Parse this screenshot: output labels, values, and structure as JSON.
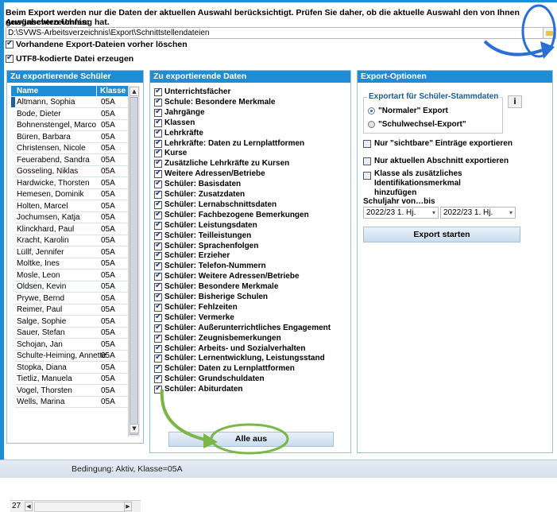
{
  "info_text": "Beim Export werden nur die Daten der aktuellen Auswahl berücksichtigt. Prüfen Sie daher, ob die aktuelle Auswahl den von Ihnen gewünschten Umfang hat.",
  "output_dir_label": "Ausgabeverzeichnis:",
  "output_dir_value": "D:\\SVWS-Arbeitsverzeichnis\\Export\\Schnittstellendateien",
  "options_top": [
    {
      "label": "Vorhandene Export-Dateien vorher löschen",
      "checked": true
    },
    {
      "label": "UTF8-kodierte Datei erzeugen",
      "checked": true
    }
  ],
  "students_panel": {
    "title": "Zu exportierende Schüler",
    "col_name": "Name",
    "col_klasse": "Klasse",
    "count": "27",
    "rows": [
      {
        "name": "Altmann, Sophia",
        "klasse": "05A"
      },
      {
        "name": "Bode, Dieter",
        "klasse": "05A"
      },
      {
        "name": "Bohnenstengel, Marco",
        "klasse": "05A"
      },
      {
        "name": "Büren, Barbara",
        "klasse": "05A"
      },
      {
        "name": "Christensen, Nicole",
        "klasse": "05A"
      },
      {
        "name": "Feuerabend, Sandra",
        "klasse": "05A"
      },
      {
        "name": "Gosseling, Niklas",
        "klasse": "05A"
      },
      {
        "name": "Hardwicke, Thorsten",
        "klasse": "05A"
      },
      {
        "name": "Hemesen, Dominik",
        "klasse": "05A"
      },
      {
        "name": "Holten, Marcel",
        "klasse": "05A"
      },
      {
        "name": "Jochumsen, Katja",
        "klasse": "05A"
      },
      {
        "name": "Klinckhard, Paul",
        "klasse": "05A"
      },
      {
        "name": "Kracht, Karolin",
        "klasse": "05A"
      },
      {
        "name": "Lüllf, Jennifer",
        "klasse": "05A"
      },
      {
        "name": "Moltke, Ines",
        "klasse": "05A"
      },
      {
        "name": "Mosle, Leon",
        "klasse": "05A"
      },
      {
        "name": "Oldsen, Kevin",
        "klasse": "05A"
      },
      {
        "name": "Prywe, Bernd",
        "klasse": "05A"
      },
      {
        "name": "Reimer, Paul",
        "klasse": "05A"
      },
      {
        "name": "Salge, Sophie",
        "klasse": "05A"
      },
      {
        "name": "Sauer, Stefan",
        "klasse": "05A"
      },
      {
        "name": "Schojan, Jan",
        "klasse": "05A"
      },
      {
        "name": "Schulte-Heiming, Annette",
        "klasse": "05A"
      },
      {
        "name": "Stopka, Diana",
        "klasse": "05A"
      },
      {
        "name": "Tietliz, Manuela",
        "klasse": "05A"
      },
      {
        "name": "Vogel, Thorsten",
        "klasse": "05A"
      },
      {
        "name": "Wells, Marina",
        "klasse": "05A"
      }
    ]
  },
  "data_panel": {
    "title": "Zu exportierende Daten",
    "items": [
      "Unterrichtsfächer",
      "Schule: Besondere Merkmale",
      "Jahrgänge",
      "Klassen",
      "Lehrkräfte",
      "Lehrkräfte: Daten zu Lernplattformen",
      "Kurse",
      "Zusätzliche Lehrkräfte zu Kursen",
      "Weitere Adressen/Betriebe",
      "Schüler: Basisdaten",
      "Schüler: Zusatzdaten",
      "Schüler: Lernabschnittsdaten",
      "Schüler: Fachbezogene Bemerkungen",
      "Schüler: Leistungsdaten",
      "Schüler: Teilleistungen",
      "Schüler: Sprachenfolgen",
      "Schüler: Erzieher",
      "Schüler: Telefon-Nummern",
      "Schüler: Weitere Adressen/Betriebe",
      "Schüler: Besondere Merkmale",
      "Schüler: Bisherige Schulen",
      "Schüler: Fehlzeiten",
      "Schüler: Vermerke",
      "Schüler: Außerunterrichtliches Engagement",
      "Schüler: Zeugnisbemerkungen",
      "Schüler: Arbeits- und Sozialverhalten",
      "Schüler: Lernentwicklung, Leistungsstand",
      "Schüler: Daten zu Lernplattformen",
      "Schüler: Grundschuldaten",
      "Schüler: Abiturdaten"
    ],
    "button_label": "Alle aus"
  },
  "options_panel": {
    "title": "Export-Optionen",
    "group_title": "Exportart für Schüler-Stammdaten",
    "radio_normal": "\"Normaler\" Export",
    "radio_wechsel": "\"Schulwechsel-Export\"",
    "info_button": "i",
    "checks": [
      "Nur \"sichtbare\" Einträge exportieren",
      "Nur aktuellen Abschnitt exportieren",
      "Klasse als zusätzliches Identifikationsmerkmal hinzufügen"
    ],
    "schuljahr_label": "Schuljahr von…bis",
    "schuljahr_von": "2022/23 1. Hj.",
    "schuljahr_bis": "2022/23 1. Hj.",
    "export_button": "Export starten"
  },
  "status_text": "Bedingung: Aktiv, Klasse=05A",
  "colors": {
    "accent": "#1f8dd6",
    "highlight": "#7ab648",
    "annotation_blue": "#2a6fd6"
  }
}
